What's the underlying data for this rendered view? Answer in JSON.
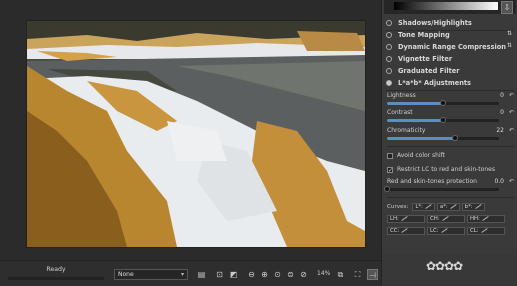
{
  "histogram": {
    "toggle_icon": "histogram-menu-icon",
    "toggle_glyph": "⇩"
  },
  "tools": [
    {
      "label": "Shadows/Highlights"
    },
    {
      "label": "Tone Mapping"
    },
    {
      "label": "Dynamic Range Compression"
    },
    {
      "label": "Vignette Filter"
    },
    {
      "label": "Graduated Filter"
    },
    {
      "label": "L*a*b* Adjustments"
    }
  ],
  "lab": {
    "lightness": {
      "label": "Lightness",
      "value": "0",
      "fraction": 0.5
    },
    "contrast": {
      "label": "Contrast",
      "value": "0",
      "fraction": 0.5
    },
    "chromaticity": {
      "label": "Chromaticity",
      "value": "22",
      "fraction": 0.61
    },
    "avoid_color_shift": {
      "label": "Avoid color shift",
      "checked": false
    },
    "restrict_lc": {
      "label": "Restrict LC to red and skin-tones",
      "checked": true
    },
    "red_skin_protection": {
      "label": "Red and skin-tones protection",
      "value": "0.0",
      "fraction": 0.0
    },
    "reset_glyph": "↶",
    "checkmark": "✓",
    "curves_label": "Curves:",
    "curves_row1": [
      "L*:",
      "a*:",
      "b*:"
    ],
    "curves_row2": [
      "LH:",
      "CH:",
      "HH:"
    ],
    "curves_row3": [
      "CC:",
      "LC:",
      "CL:"
    ]
  },
  "bottom": {
    "status": "Ready",
    "profile": "None",
    "profile_arrow": "▾",
    "zoom": "14%",
    "icons": {
      "before_after": "▤",
      "crop": "⊡",
      "color": "◩",
      "zoom_out": "⊖",
      "zoom_in": "⊕",
      "zoom_fit": "⊙",
      "zoom_100": "⊜",
      "zoom_fill": "⊘",
      "newwin": "⧉",
      "fullscreen": "⛶",
      "panel": "⊣"
    }
  },
  "logo": "✿✿✿✿"
}
